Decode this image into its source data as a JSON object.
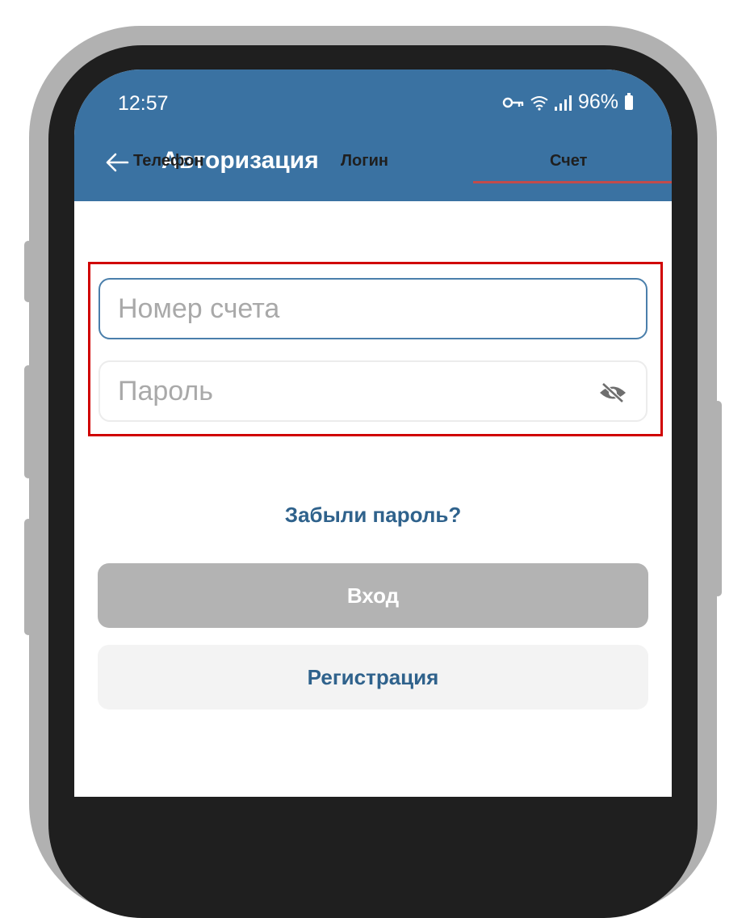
{
  "status_bar": {
    "time": "12:57",
    "battery": "96%",
    "icons": [
      "vpn-key-icon",
      "wifi-icon",
      "signal-icon",
      "battery-icon"
    ]
  },
  "app_bar": {
    "title": "Авторизация",
    "back_icon": "arrow-left-icon",
    "color": "#3a72a2"
  },
  "tabs": [
    {
      "label": "Телефон",
      "active": false
    },
    {
      "label": "Логин",
      "active": false
    },
    {
      "label": "Счет",
      "active": true
    }
  ],
  "form": {
    "account_placeholder": "Номер счета",
    "account_value": "",
    "password_placeholder": "Пароль",
    "password_value": "",
    "password_visibility_icon": "eye-off-icon"
  },
  "links": {
    "forgot_password": "Забыли пароль?"
  },
  "buttons": {
    "login": "Вход",
    "register": "Регистрация"
  },
  "colors": {
    "accent": "#3a72a2",
    "link": "#2f628c",
    "tab_indicator": "#c24b4b",
    "highlight": "#d00000",
    "disabled_button": "#b3b3b3"
  }
}
